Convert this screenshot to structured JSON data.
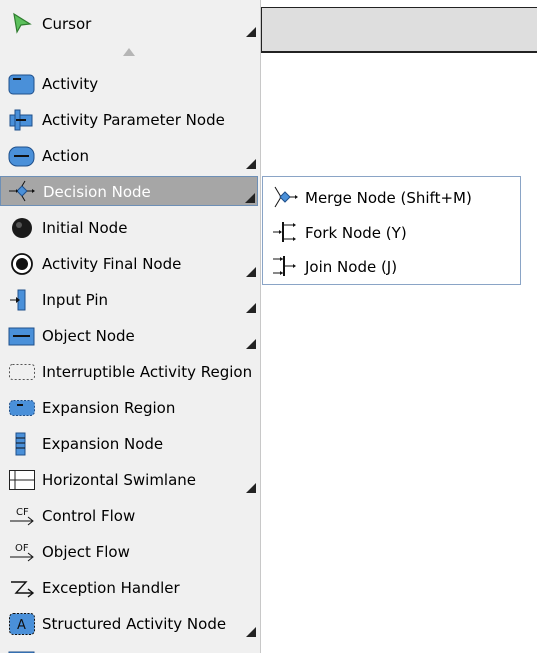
{
  "palette": {
    "items": [
      {
        "label": "Cursor",
        "icon": "cursor-arrow-icon"
      },
      {
        "label": "Activity",
        "icon": "activity-icon"
      },
      {
        "label": "Activity Parameter Node",
        "icon": "activity-parameter-node-icon"
      },
      {
        "label": "Action",
        "icon": "action-icon"
      },
      {
        "label": "Decision Node",
        "icon": "decision-node-icon"
      },
      {
        "label": "Initial Node",
        "icon": "initial-node-icon"
      },
      {
        "label": "Activity Final Node",
        "icon": "activity-final-node-icon"
      },
      {
        "label": "Input Pin",
        "icon": "input-pin-icon"
      },
      {
        "label": "Object Node",
        "icon": "object-node-icon"
      },
      {
        "label": "Interruptible Activity Region",
        "icon": "interruptible-region-icon"
      },
      {
        "label": "Expansion Region",
        "icon": "expansion-region-icon"
      },
      {
        "label": "Expansion Node",
        "icon": "expansion-node-icon"
      },
      {
        "label": "Horizontal Swimlane",
        "icon": "horizontal-swimlane-icon"
      },
      {
        "label": "Control Flow",
        "icon": "control-flow-icon",
        "icon_text": "CF"
      },
      {
        "label": "Object Flow",
        "icon": "object-flow-icon",
        "icon_text": "OF"
      },
      {
        "label": "Exception Handler",
        "icon": "exception-handler-icon"
      },
      {
        "label": "Structured Activity Node",
        "icon": "structured-activity-node-icon",
        "icon_text": "A"
      }
    ],
    "selected": "Decision Node"
  },
  "flyout": {
    "items": [
      {
        "label": "Merge Node (Shift+M)",
        "icon": "merge-node-icon"
      },
      {
        "label": "Fork Node (Y)",
        "icon": "fork-node-icon"
      },
      {
        "label": "Join Node (J)",
        "icon": "join-node-icon"
      }
    ]
  },
  "colors": {
    "palette_bg": "#f0f0f0",
    "selected_bg": "#a6a6a6",
    "icon_blue": "#4a90d9",
    "flyout_border": "#8aa4c6"
  }
}
